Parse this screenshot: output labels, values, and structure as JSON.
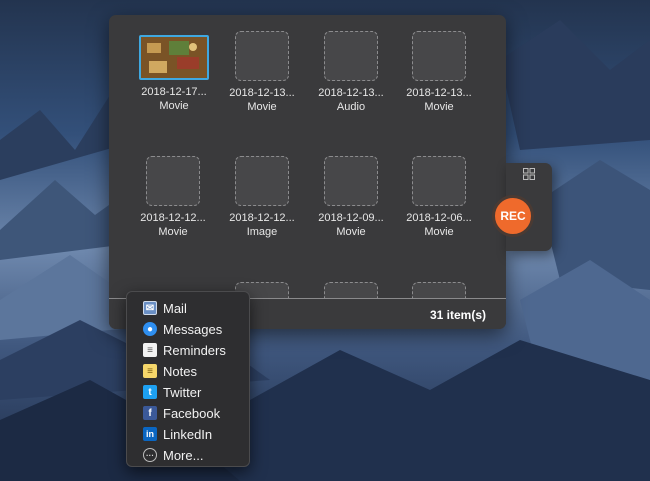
{
  "items": [
    {
      "name": "2018-12-17...",
      "type": "Movie",
      "selected": true
    },
    {
      "name": "2018-12-13...",
      "type": "Movie"
    },
    {
      "name": "2018-12-13...",
      "type": "Audio"
    },
    {
      "name": "2018-12-13...",
      "type": "Movie"
    },
    {
      "name": "2018-12-12...",
      "type": "Movie"
    },
    {
      "name": "2018-12-12...",
      "type": "Image"
    },
    {
      "name": "2018-12-09...",
      "type": "Movie"
    },
    {
      "name": "2018-12-06...",
      "type": "Movie"
    }
  ],
  "footer": {
    "count": "31 item(s)"
  },
  "rec": {
    "label": "REC"
  },
  "share_menu": [
    {
      "label": "Mail",
      "icon": "mail-icon"
    },
    {
      "label": "Messages",
      "icon": "messages-icon"
    },
    {
      "label": "Reminders",
      "icon": "reminders-icon"
    },
    {
      "label": "Notes",
      "icon": "notes-icon"
    },
    {
      "label": "Twitter",
      "icon": "twitter-icon"
    },
    {
      "label": "Facebook",
      "icon": "facebook-icon"
    },
    {
      "label": "LinkedIn",
      "icon": "linkedin-icon"
    },
    {
      "label": "More...",
      "icon": "more-icon"
    }
  ],
  "colors": {
    "panel": "#3a3a3c",
    "selection": "#3fa8e0",
    "rec": "#ef6a2c"
  }
}
